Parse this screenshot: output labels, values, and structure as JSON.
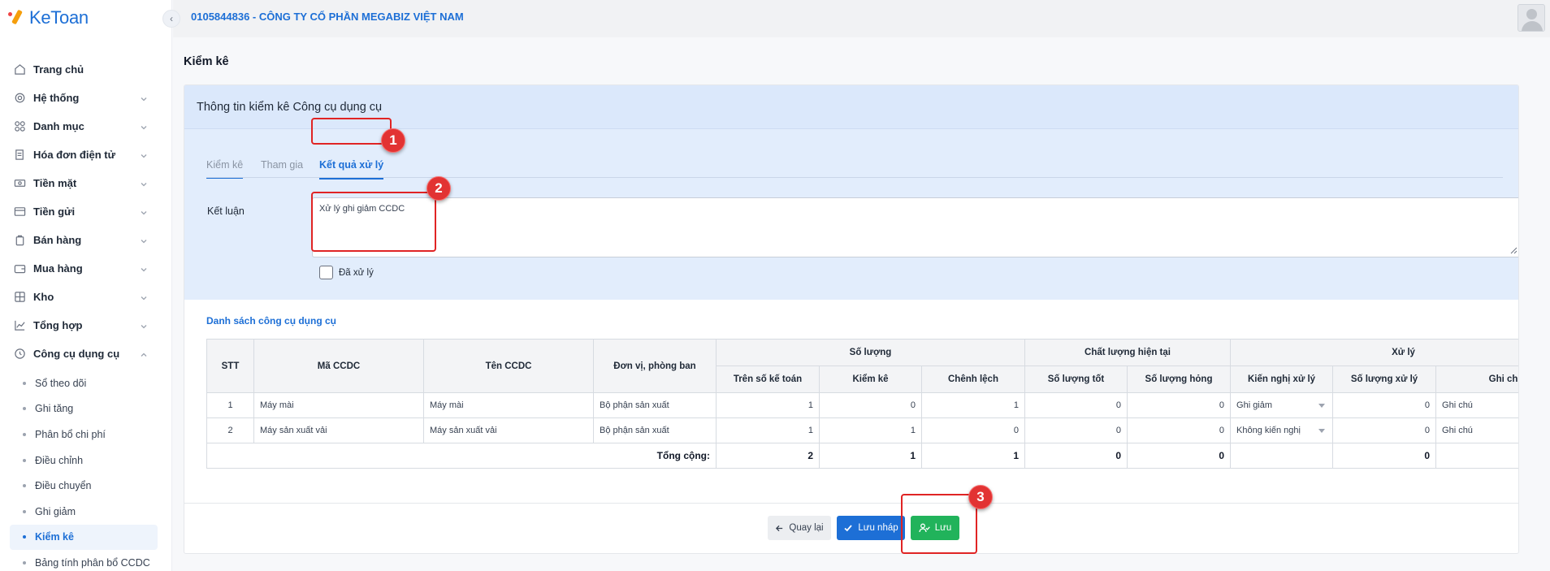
{
  "app": {
    "logo_text": "KeToan"
  },
  "header": {
    "company": "0105844836 - CÔNG TY CỔ PHẦN MEGABIZ VIỆT NAM"
  },
  "sidebar": {
    "items": [
      {
        "label": "Trang chủ",
        "icon": "home-icon"
      },
      {
        "label": "Hệ thống",
        "icon": "gear-icon"
      },
      {
        "label": "Danh mục",
        "icon": "grid-icon"
      },
      {
        "label": "Hóa đơn điện tử",
        "icon": "invoice-icon"
      },
      {
        "label": "Tiền mặt",
        "icon": "cash-icon"
      },
      {
        "label": "Tiền gửi",
        "icon": "card-icon"
      },
      {
        "label": "Bán hàng",
        "icon": "bag-icon"
      },
      {
        "label": "Mua hàng",
        "icon": "wallet-icon"
      },
      {
        "label": "Kho",
        "icon": "warehouse-icon"
      },
      {
        "label": "Tổng hợp",
        "icon": "chart-icon"
      },
      {
        "label": "Công cụ dụng cụ",
        "icon": "tools-icon"
      }
    ],
    "sub_items": [
      "Sổ theo dõi",
      "Ghi tăng",
      "Phân bổ chi phí",
      "Điều chỉnh",
      "Điều chuyển",
      "Ghi giảm",
      "Kiểm kê",
      "Bảng tính phân bổ CCDC"
    ],
    "active_sub": "Kiểm kê"
  },
  "page": {
    "title": "Kiểm kê",
    "card_title": "Thông tin kiểm kê Công cụ dụng cụ",
    "tabs": [
      "Kiểm kê",
      "Tham gia",
      "Kết quả xử lý"
    ],
    "ketluan_label": "Kết luận",
    "ketluan_value": "Xử lý ghi giảm CCDC",
    "processed_label": "Đã xử lý",
    "list_title": "Danh sách công cụ dụng cụ"
  },
  "table": {
    "headers": {
      "stt": "STT",
      "ma": "Mã CCDC",
      "ten": "Tên CCDC",
      "donvi": "Đơn vị, phòng ban",
      "soluong": "Số lượng",
      "chatluong": "Chất lượng hiện tại",
      "xuly": "Xử lý",
      "tren_so": "Trên số kế toán",
      "kiemke": "Kiểm kê",
      "chenhlech": "Chênh lệch",
      "tot": "Số lượng tốt",
      "hong": "Số lượng hỏng",
      "kiennghi": "Kiến nghị xử lý",
      "sl_xuly": "Số lượng xử lý",
      "ghichu": "Ghi chú"
    },
    "rows": [
      {
        "stt": "1",
        "ma": "Máy mài",
        "ten": "Máy mài",
        "donvi": "Bộ phận sản xuất",
        "tren_so": "1",
        "kiemke": "0",
        "chenhlech": "1",
        "tot": "0",
        "hong": "0",
        "kiennghi": "Ghi giảm",
        "sl_xuly": "0",
        "ghichu": "Ghi chú"
      },
      {
        "stt": "2",
        "ma": "Máy sản xuất vải",
        "ten": "Máy sản xuất vải",
        "donvi": "Bộ phận sản xuất",
        "tren_so": "1",
        "kiemke": "1",
        "chenhlech": "0",
        "tot": "0",
        "hong": "0",
        "kiennghi": "Không kiến nghị",
        "sl_xuly": "0",
        "ghichu": "Ghi chú"
      }
    ],
    "total": {
      "label": "Tổng cộng:",
      "tren_so": "2",
      "kiemke": "1",
      "chenhlech": "1",
      "tot": "0",
      "hong": "0",
      "sl_xuly": "0"
    }
  },
  "buttons": {
    "back": "Quay lại",
    "draft": "Lưu nháp",
    "save": "Lưu"
  },
  "annotations": [
    "1",
    "2",
    "3"
  ]
}
